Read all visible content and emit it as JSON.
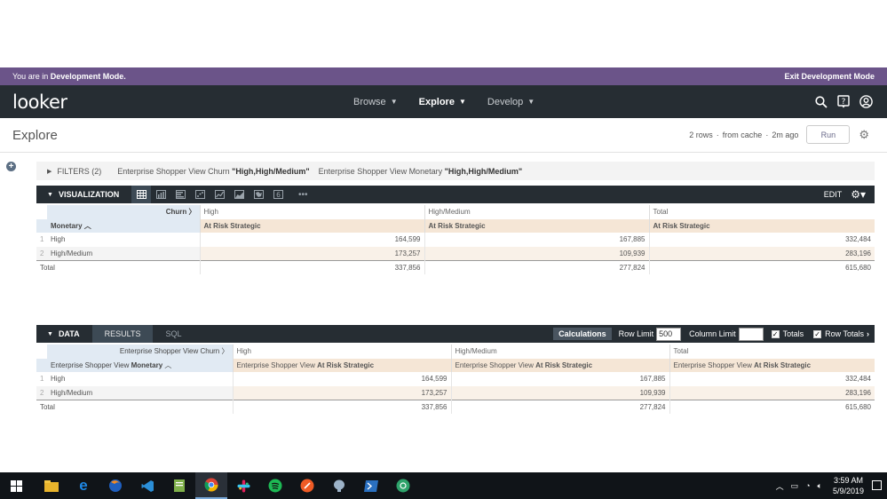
{
  "dev_banner": {
    "prefix": "You are in ",
    "mode": "Development Mode.",
    "exit": "Exit Development Mode"
  },
  "nav": {
    "logo": "looker",
    "menu": [
      {
        "label": "Browse",
        "active": false
      },
      {
        "label": "Explore",
        "active": true
      },
      {
        "label": "Develop",
        "active": false
      }
    ],
    "icons": [
      "search-icon",
      "help-icon",
      "account-icon"
    ]
  },
  "explore": {
    "title": "Explore",
    "rows": "2 rows",
    "cache": "from cache",
    "age": "2m ago",
    "run": "Run",
    "sep": "·"
  },
  "filters": {
    "label": "FILTERS (2)",
    "items": [
      {
        "field": "Enterprise Shopper View Churn ",
        "value": "\"High,High/Medium\""
      },
      {
        "field": "Enterprise Shopper View Monetary ",
        "value": "\"High,High/Medium\""
      }
    ]
  },
  "visualization": {
    "title": "VISUALIZATION",
    "edit": "EDIT",
    "icons": [
      "table-icon",
      "column-chart-icon",
      "bar-chart-icon",
      "scatter-icon",
      "line-chart-icon",
      "area-chart-icon",
      "map-icon",
      "single-value-icon",
      "more-icon"
    ],
    "pivot_label": "Churn",
    "dim_label": "Monetary",
    "columns": [
      "High",
      "High/Medium",
      "Total"
    ],
    "measure": "At Risk Strategic",
    "rows": [
      {
        "num": "1",
        "dim": "High",
        "values": [
          "164,599",
          "167,885",
          "332,484"
        ]
      },
      {
        "num": "2",
        "dim": "High/Medium",
        "values": [
          "173,257",
          "109,939",
          "283,196"
        ]
      }
    ],
    "total": {
      "label": "Total",
      "values": [
        "337,856",
        "277,824",
        "615,680"
      ]
    }
  },
  "data": {
    "title": "DATA",
    "tabs": [
      "RESULTS",
      "SQL"
    ],
    "calculations": "Calculations",
    "row_limit_label": "Row Limit",
    "row_limit": "500",
    "column_limit_label": "Column Limit",
    "column_limit": "",
    "totals": "Totals",
    "row_totals": "Row Totals",
    "pivot_prefix": "Enterprise Shopper View ",
    "pivot_label": "Churn",
    "dim_prefix": "Enterprise Shopper View ",
    "dim_label": "Monetary",
    "measure_prefix": "Enterprise Shopper View ",
    "measure": "At Risk Strategic",
    "columns": [
      "High",
      "High/Medium",
      "Total"
    ],
    "rows": [
      {
        "num": "1",
        "dim": "High",
        "values": [
          "164,599",
          "167,885",
          "332,484"
        ]
      },
      {
        "num": "2",
        "dim": "High/Medium",
        "values": [
          "173,257",
          "109,939",
          "283,196"
        ]
      }
    ],
    "total": {
      "label": "Total",
      "values": [
        "337,856",
        "277,824",
        "615,680"
      ]
    }
  },
  "taskbar": {
    "apps": [
      "windows-start-icon",
      "file-explorer-icon",
      "edge-icon",
      "firefox-icon",
      "vscode-icon",
      "notepad-icon",
      "chrome-icon",
      "slack-icon",
      "spotify-icon",
      "postman-icon",
      "pgadmin-icon",
      "powershell-icon",
      "other-app-icon"
    ],
    "time": "3:59 AM",
    "date": "5/9/2019"
  }
}
